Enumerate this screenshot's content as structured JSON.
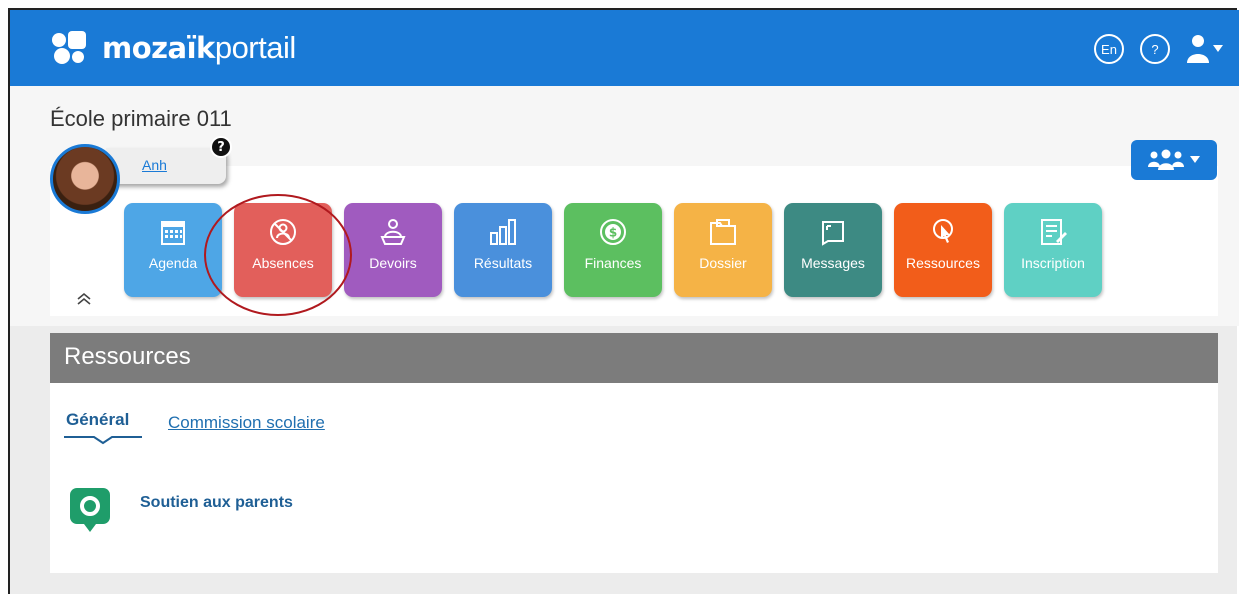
{
  "app": {
    "brand_bold": "mozaïk",
    "brand_light": "portail"
  },
  "top_bar": {
    "language_label": "En",
    "help_label": "?",
    "color": "#1a7ad6"
  },
  "school": {
    "name": "École primaire 011"
  },
  "student": {
    "name": "Anh",
    "help_badge": "?"
  },
  "tiles": [
    {
      "label": "Agenda",
      "icon": "calendar-icon",
      "color": "#4ea6e6"
    },
    {
      "label": "Absences",
      "icon": "absence-person-icon",
      "color": "#e25f5b"
    },
    {
      "label": "Devoirs",
      "icon": "homework-person-icon",
      "color": "#a05bbf"
    },
    {
      "label": "Résultats",
      "icon": "bar-chart-icon",
      "color": "#4a90dc"
    },
    {
      "label": "Finances",
      "icon": "dollar-coin-icon",
      "color": "#5cbf60"
    },
    {
      "label": "Dossier",
      "icon": "folder-icon",
      "color": "#f5b346"
    },
    {
      "label": "Messages",
      "icon": "message-note-icon",
      "color": "#3d8a83"
    },
    {
      "label": "Ressources",
      "icon": "resource-pointer-icon",
      "color": "#f25d1a"
    },
    {
      "label": "Inscription",
      "icon": "form-edit-icon",
      "color": "#5fd0c4"
    }
  ],
  "panel": {
    "title": "Ressources",
    "tabs": [
      {
        "label": "Général",
        "active": true
      },
      {
        "label": "Commission scolaire",
        "active": false
      }
    ],
    "items": [
      {
        "label": "Soutien aux parents",
        "icon": "support-bubble-icon",
        "color": "#1f9d6a"
      }
    ]
  }
}
